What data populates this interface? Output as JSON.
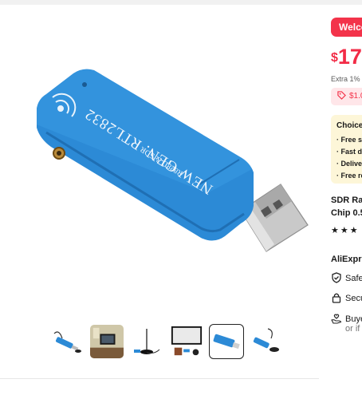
{
  "panel": {
    "welcome_badge": "Welco",
    "price_currency": "$",
    "price_value": "17",
    "extra_discount": "Extra 1% o",
    "coupon": "$1.0",
    "choice": {
      "title": "Choice",
      "items": [
        "· Free sh",
        "· Fast de",
        "· Delive",
        "· Free re"
      ]
    },
    "product_title_line1": "SDR Rac",
    "product_title_line2": "Chip 0.5",
    "rating_stars": "★★★",
    "store_name": "AliExpre",
    "perks": [
      {
        "label": "Safe",
        "icon": "shield-check-icon"
      },
      {
        "label": "Secu",
        "icon": "lock-icon"
      },
      {
        "label": "Buye",
        "sub": "or if",
        "icon": "hand-heart-icon"
      }
    ]
  },
  "main_image": {
    "usb_label_line1": "NEW GEN. RTL2832",
    "usb_label_line2": "R828D & SDR"
  },
  "thumbnails": [
    {
      "name": "usb-with-antenna",
      "active": false
    },
    {
      "name": "tv-room",
      "active": false
    },
    {
      "name": "antenna",
      "active": false
    },
    {
      "name": "tv-with-accessories",
      "active": false
    },
    {
      "name": "usb-dongle",
      "active": true
    },
    {
      "name": "usb-with-antenna-2",
      "active": false
    }
  ],
  "colors": {
    "accent_red": "#f3334a",
    "usb_blue": "#2d8fd8",
    "choice_bg": "#fdf6d8"
  }
}
